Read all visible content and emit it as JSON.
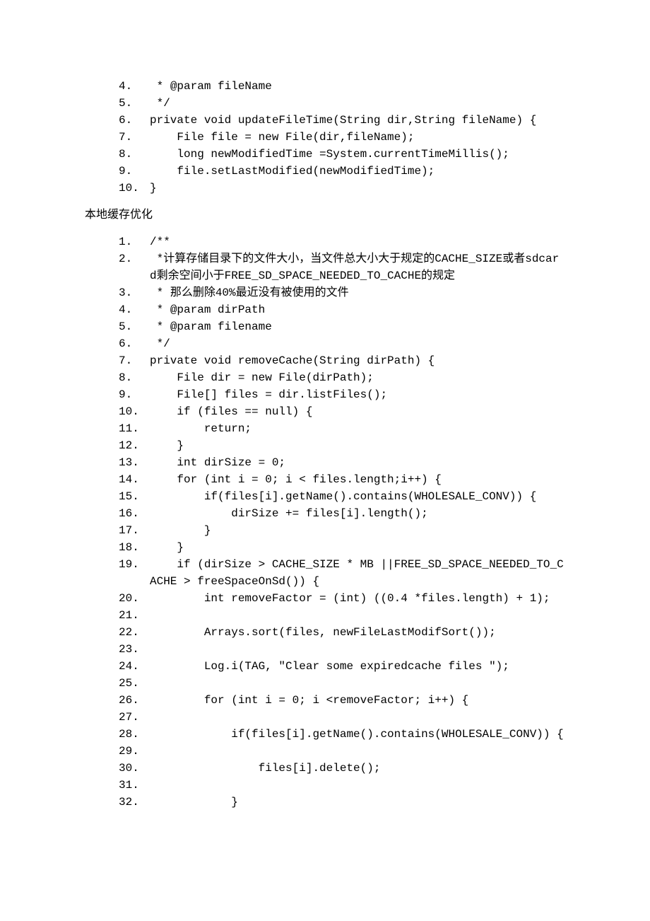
{
  "block1": {
    "lines": [
      {
        "n": "4.",
        "c": " * @param fileName  "
      },
      {
        "n": "5.",
        "c": " */  "
      },
      {
        "n": "6.",
        "c": "private void updateFileTime(String dir,String fileName) {  "
      },
      {
        "n": "7.",
        "c": "    File file = new File(dir,fileName);       "
      },
      {
        "n": "8.",
        "c": "    long newModifiedTime =System.currentTimeMillis();  "
      },
      {
        "n": "9.",
        "c": "    file.setLastModified(newModifiedTime);  "
      },
      {
        "n": "10.",
        "c": "}  "
      }
    ]
  },
  "heading": "本地缓存优化",
  "block2": {
    "lines": [
      {
        "n": "1.",
        "c": "/** "
      },
      {
        "n": "2.",
        "c": " *计算存储目录下的文件大小，当文件总大小大于规定的CACHE_SIZE或者sdcard剩余空间小于FREE_SD_SPACE_NEEDED_TO_CACHE的规定 "
      },
      {
        "n": "3.",
        "c": " * 那么删除40%最近没有被使用的文件 "
      },
      {
        "n": "4.",
        "c": " * @param dirPath "
      },
      {
        "n": "5.",
        "c": " * @param filename "
      },
      {
        "n": "6.",
        "c": " */  "
      },
      {
        "n": "7.",
        "c": "private void removeCache(String dirPath) {  "
      },
      {
        "n": "8.",
        "c": "    File dir = new File(dirPath);  "
      },
      {
        "n": "9.",
        "c": "    File[] files = dir.listFiles();  "
      },
      {
        "n": "10.",
        "c": "    if (files == null) {  "
      },
      {
        "n": "11.",
        "c": "        return;  "
      },
      {
        "n": "12.",
        "c": "    }  "
      },
      {
        "n": "13.",
        "c": "    int dirSize = 0;  "
      },
      {
        "n": "14.",
        "c": "    for (int i = 0; i < files.length;i++) {  "
      },
      {
        "n": "15.",
        "c": "        if(files[i].getName().contains(WHOLESALE_CONV)) {  "
      },
      {
        "n": "16.",
        "c": "            dirSize += files[i].length();  "
      },
      {
        "n": "17.",
        "c": "        }  "
      },
      {
        "n": "18.",
        "c": "    }  "
      },
      {
        "n": "19.",
        "c": "    if (dirSize > CACHE_SIZE * MB ||FREE_SD_SPACE_NEEDED_TO_CACHE > freeSpaceOnSd()) {  "
      },
      {
        "n": "20.",
        "c": "        int removeFactor = (int) ((0.4 *files.length) + 1);  "
      },
      {
        "n": "21.",
        "c": "  "
      },
      {
        "n": "22.",
        "c": "        Arrays.sort(files, newFileLastModifSort());  "
      },
      {
        "n": "23.",
        "c": "  "
      },
      {
        "n": "24.",
        "c": "        Log.i(TAG, \"Clear some expiredcache files \");  "
      },
      {
        "n": "25.",
        "c": "  "
      },
      {
        "n": "26.",
        "c": "        for (int i = 0; i <removeFactor; i++) {  "
      },
      {
        "n": "27.",
        "c": "  "
      },
      {
        "n": "28.",
        "c": "            if(files[i].getName().contains(WHOLESALE_CONV)) {  "
      },
      {
        "n": "29.",
        "c": "  "
      },
      {
        "n": "30.",
        "c": "                files[i].delete();               "
      },
      {
        "n": "31.",
        "c": "  "
      },
      {
        "n": "32.",
        "c": "            }  "
      }
    ]
  }
}
